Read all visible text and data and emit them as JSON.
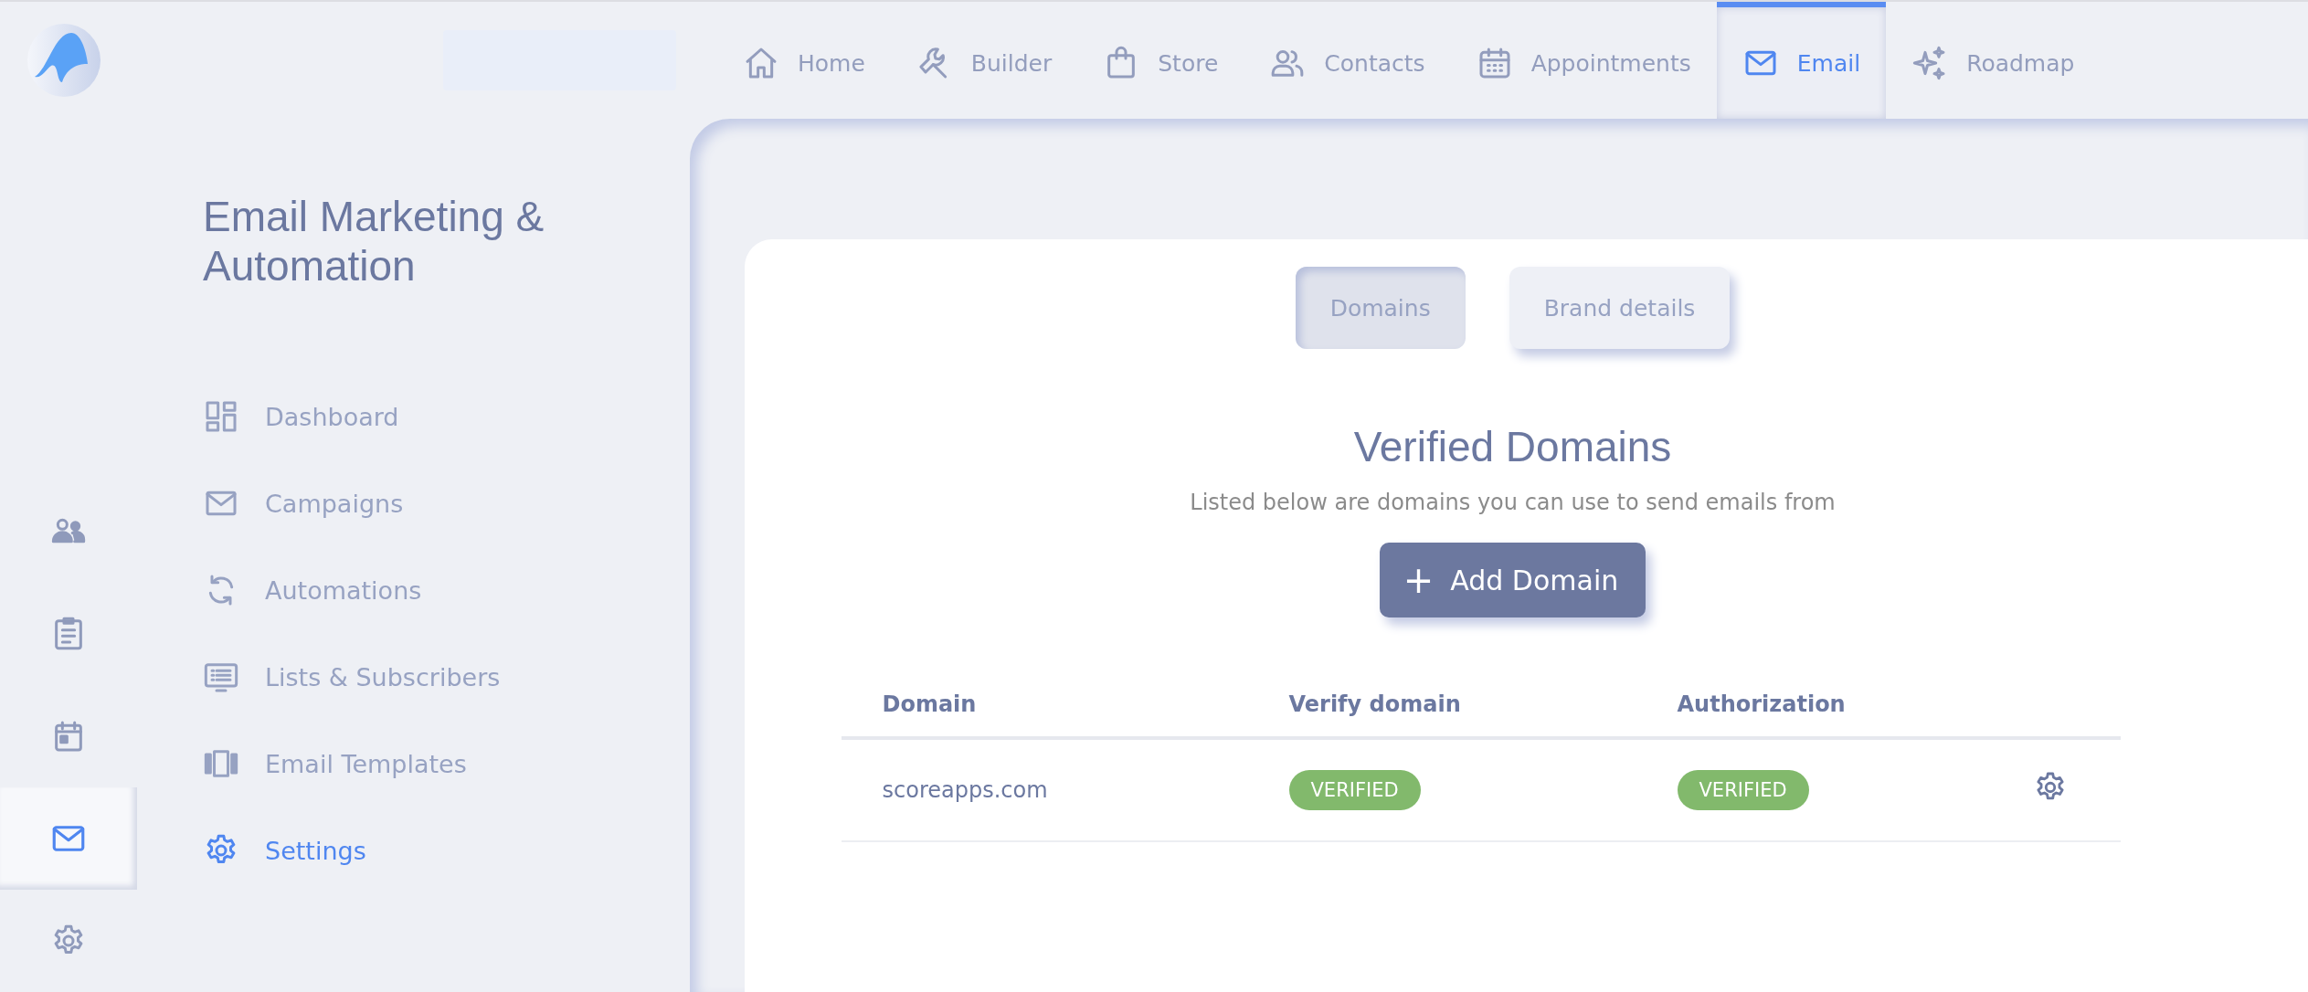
{
  "top_nav": {
    "tabs": [
      {
        "label": "Home",
        "selected": false
      },
      {
        "label": "Builder",
        "selected": false
      },
      {
        "label": "Store",
        "selected": false
      },
      {
        "label": "Contacts",
        "selected": false
      },
      {
        "label": "Appointments",
        "selected": false
      },
      {
        "label": "Email",
        "selected": true
      },
      {
        "label": "Roadmap",
        "selected": false
      }
    ]
  },
  "icon_rail": {
    "items": [
      {
        "selected": false
      },
      {
        "selected": false
      },
      {
        "selected": false
      },
      {
        "selected": true
      },
      {
        "selected": false
      }
    ]
  },
  "sidebar": {
    "title": "Email Marketing & Automation",
    "items": [
      {
        "label": "Dashboard",
        "selected": false
      },
      {
        "label": "Campaigns",
        "selected": false
      },
      {
        "label": "Automations",
        "selected": false
      },
      {
        "label": "Lists & Subscribers",
        "selected": false
      },
      {
        "label": "Email Templates",
        "selected": false
      },
      {
        "label": "Settings",
        "selected": true
      }
    ]
  },
  "main": {
    "tabs": [
      {
        "label": "Domains",
        "selected": true
      },
      {
        "label": "Brand details",
        "selected": false
      }
    ],
    "heading": "Verified Domains",
    "subtitle": "Listed below are domains you can use to send emails from",
    "add_button": {
      "icon": "+",
      "label": "Add Domain"
    },
    "table": {
      "columns": [
        "Domain",
        "Verify domain",
        "Authorization"
      ],
      "rows": [
        {
          "domain": "scoreapps.com",
          "verify_status": "VERIFIED",
          "authorization_status": "VERIFIED"
        }
      ]
    }
  }
}
